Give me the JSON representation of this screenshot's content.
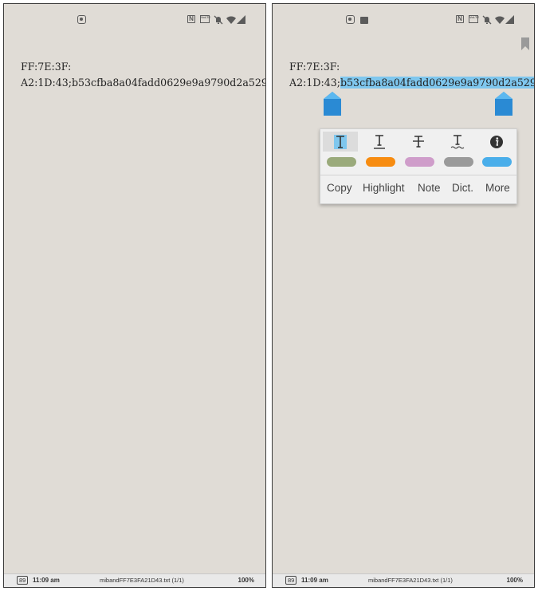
{
  "left": {
    "text": {
      "line1": "FF:7E:3F:",
      "line2": "A2:1D:43;b53cfba8a04fadd0629e9a9790d2a529"
    },
    "footer": {
      "battery": "89",
      "time": "11:09 am",
      "filename": "mibandFF7E3FA21D43.txt (1/1)",
      "percent": "100%"
    }
  },
  "right": {
    "text": {
      "line1": "FF:7E:3F:",
      "line2_prefix": "A2:1D:43;",
      "line2_selected": "b53cfba8a04fadd0629e9a9790d2a529"
    },
    "popup": {
      "format_buttons": [
        "text-style-icon",
        "underline-icon",
        "strikethrough-icon",
        "squiggle-underline-icon",
        "info-icon"
      ],
      "colors": [
        "#9aaa7b",
        "#f78c11",
        "#cf9dca",
        "#9a9a9a",
        "#4aaeea"
      ],
      "actions": [
        "Copy",
        "Highlight",
        "Note",
        "Dict.",
        "More"
      ]
    },
    "footer": {
      "battery": "89",
      "time": "11:09 am",
      "filename": "mibandFF7E3FA21D43.txt (1/1)",
      "percent": "100%"
    }
  },
  "colors": {
    "page_bg": "#e0dcd6",
    "selection": "#7fc7ee",
    "handle": "#2a8ad4"
  }
}
